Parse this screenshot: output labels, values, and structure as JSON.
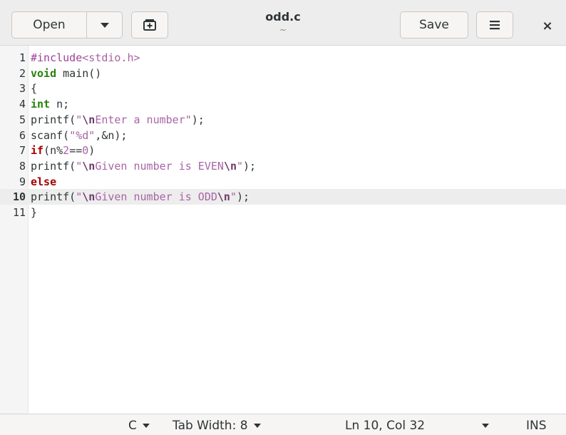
{
  "header": {
    "open_label": "Open",
    "open_dropdown_icon": "chevron-down-icon",
    "new_tab_icon": "new-tab-icon",
    "title": "odd.c",
    "subtitle": "~",
    "save_label": "Save",
    "menu_icon": "hamburger-menu-icon",
    "close_glyph": "×"
  },
  "editor": {
    "current_line": 10,
    "lines": [
      {
        "num": "1",
        "tokens": [
          {
            "t": "#include",
            "c": "pre"
          },
          {
            "t": "<stdio.h>",
            "c": "str"
          }
        ]
      },
      {
        "num": "2",
        "tokens": [
          {
            "t": "void",
            "c": "type"
          },
          {
            "t": " main()",
            "c": ""
          }
        ]
      },
      {
        "num": "3",
        "tokens": [
          {
            "t": "{",
            "c": ""
          }
        ]
      },
      {
        "num": "4",
        "tokens": [
          {
            "t": "int",
            "c": "type"
          },
          {
            "t": " n;",
            "c": ""
          }
        ]
      },
      {
        "num": "5",
        "tokens": [
          {
            "t": "printf(",
            "c": ""
          },
          {
            "t": "\"",
            "c": "str"
          },
          {
            "t": "\\n",
            "c": "esc"
          },
          {
            "t": "Enter a number\"",
            "c": "str"
          },
          {
            "t": ");",
            "c": ""
          }
        ]
      },
      {
        "num": "6",
        "tokens": [
          {
            "t": "scanf(",
            "c": ""
          },
          {
            "t": "\"%d\"",
            "c": "str"
          },
          {
            "t": ",&n);",
            "c": ""
          }
        ]
      },
      {
        "num": "7",
        "tokens": [
          {
            "t": "if",
            "c": "kw"
          },
          {
            "t": "(n%",
            "c": ""
          },
          {
            "t": "2",
            "c": "num"
          },
          {
            "t": "==",
            "c": ""
          },
          {
            "t": "0",
            "c": "num"
          },
          {
            "t": ")",
            "c": ""
          }
        ]
      },
      {
        "num": "8",
        "tokens": [
          {
            "t": "printf(",
            "c": ""
          },
          {
            "t": "\"",
            "c": "str"
          },
          {
            "t": "\\n",
            "c": "esc"
          },
          {
            "t": "Given number is EVEN",
            "c": "str"
          },
          {
            "t": "\\n",
            "c": "esc"
          },
          {
            "t": "\"",
            "c": "str"
          },
          {
            "t": ");",
            "c": ""
          }
        ]
      },
      {
        "num": "9",
        "tokens": [
          {
            "t": "else",
            "c": "kw"
          }
        ]
      },
      {
        "num": "10",
        "tokens": [
          {
            "t": "printf(",
            "c": ""
          },
          {
            "t": "\"",
            "c": "str"
          },
          {
            "t": "\\n",
            "c": "esc"
          },
          {
            "t": "Given number is ODD",
            "c": "str"
          },
          {
            "t": "\\n",
            "c": "esc"
          },
          {
            "t": "\"",
            "c": "str"
          },
          {
            "t": ");",
            "c": ""
          }
        ]
      },
      {
        "num": "11",
        "tokens": [
          {
            "t": "}",
            "c": ""
          }
        ]
      }
    ]
  },
  "statusbar": {
    "language": "C",
    "tab_width": "Tab Width: 8",
    "position": "Ln 10, Col 32",
    "mode": "INS"
  },
  "colors": {
    "preprocessor": "#a0409a",
    "string": "#a865a4",
    "type": "#26820a",
    "keyword": "#a40000",
    "current_line_bg": "#ededed"
  }
}
